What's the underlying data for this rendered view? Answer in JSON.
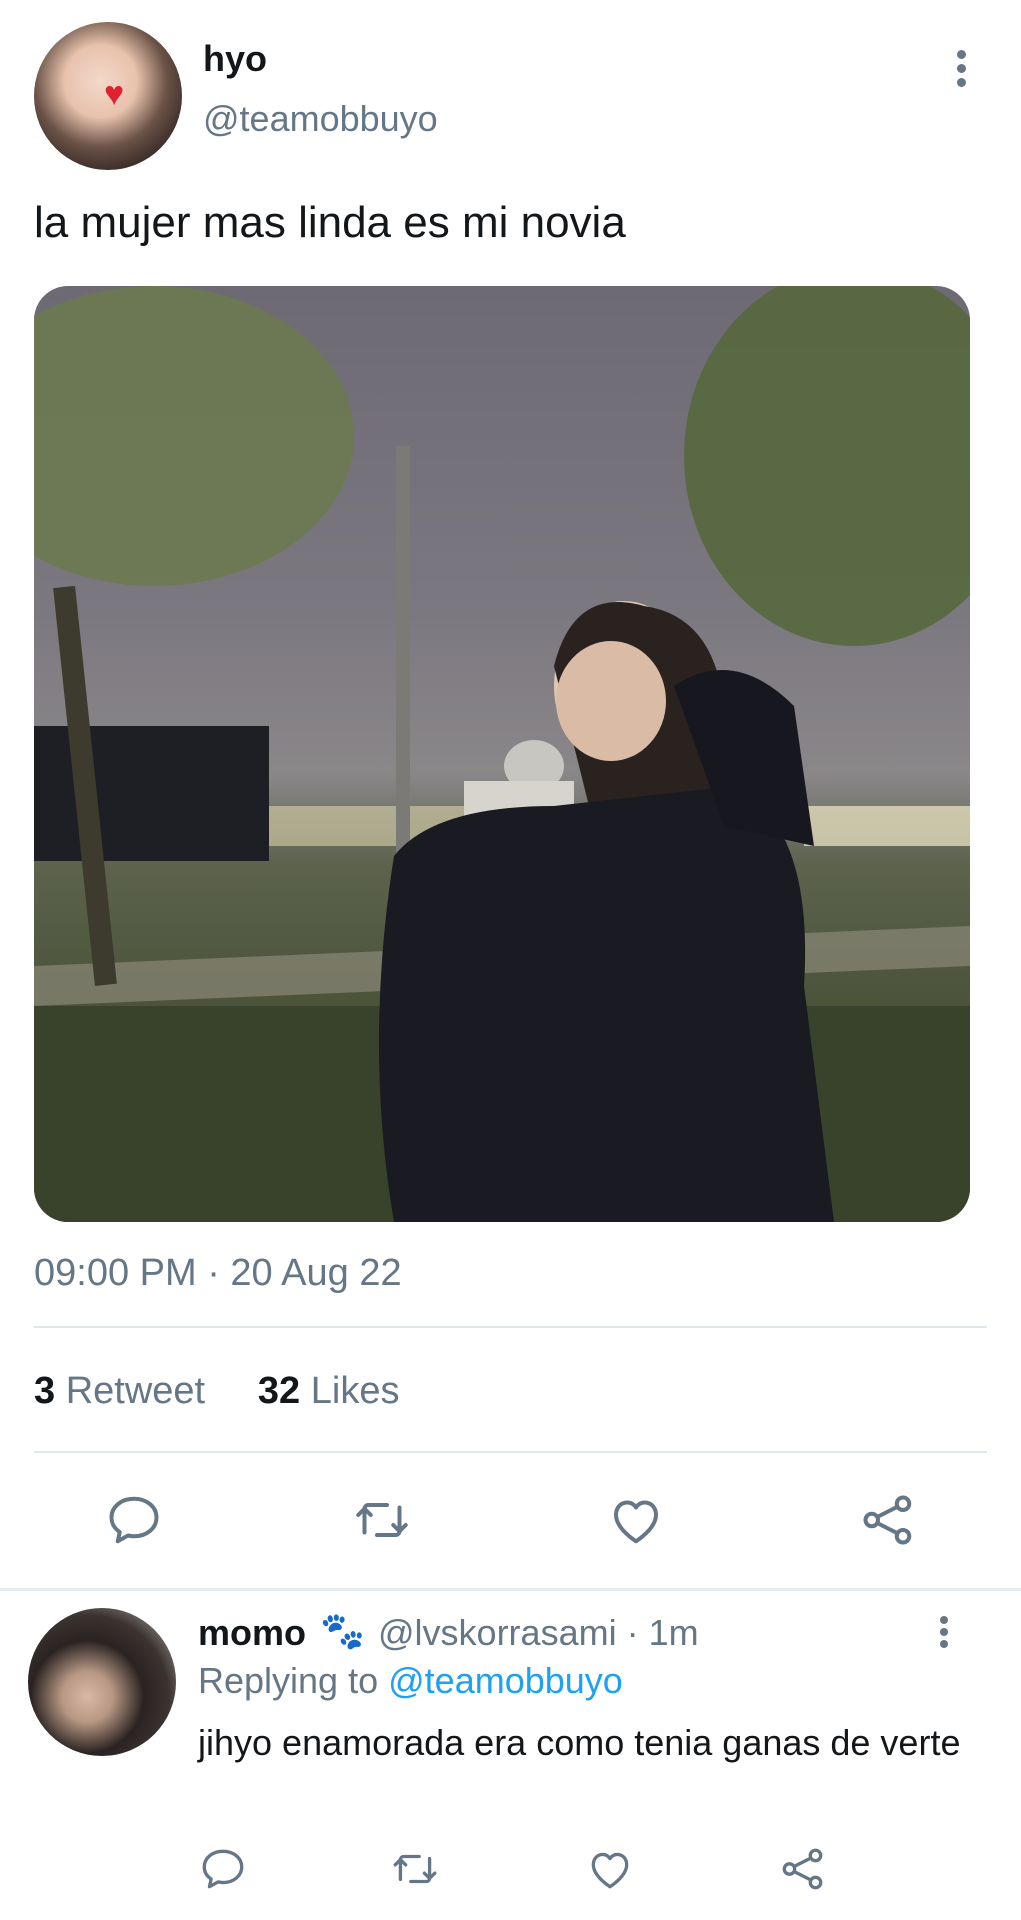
{
  "tweet": {
    "author_name": "hyo",
    "author_handle": "@teamobbuyo",
    "text": "la mujer mas linda es mi novia",
    "timestamp": "09:00 PM · 20 Aug 22",
    "retweet_count": "3",
    "retweet_label": "Retweet",
    "like_count": "32",
    "like_label": "Likes"
  },
  "reply": {
    "author_name": "momo",
    "author_handle": "@lvskorrasami · 1m",
    "replying_prefix": "Replying to",
    "replying_to": "@teamobbuyo",
    "text": "jihyo enamorada era como tenia ganas de verte"
  },
  "icons": {
    "reply": "reply-icon",
    "retweet": "retweet-icon",
    "like": "heart-icon",
    "share": "share-icon",
    "more": "more-vertical-icon",
    "paw": "paw-icon"
  },
  "colors": {
    "text_primary": "#14171a",
    "text_secondary": "#657786",
    "link": "#1da1f2",
    "divider": "#e1e8ed"
  }
}
